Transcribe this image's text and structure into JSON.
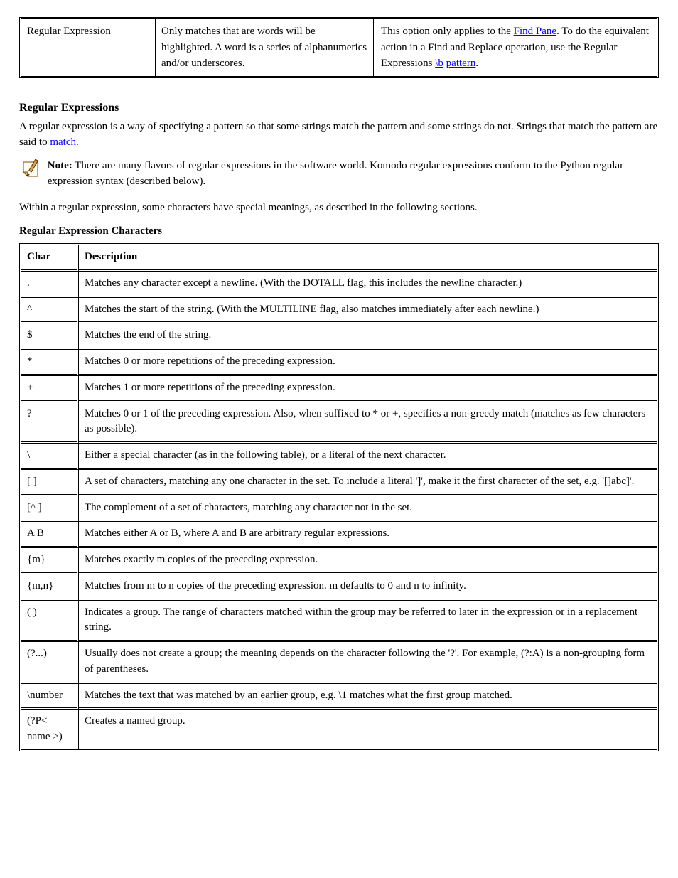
{
  "top": {
    "row": {
      "regex_label": "Regular Expression",
      "desc": "Only matches that are words will be highlighted. A word is a series of alphanumerics and/or underscores.",
      "note_prefix": "This option only applies to the ",
      "note_link1": "Find Pane",
      "note_mid": ". To do the equivalent action in a Find and Replace operation, use the Regular Expressions ",
      "note_link2": "\\b",
      "note_tail": " ",
      "note_link3": "pattern",
      "note_period": "."
    }
  },
  "section": {
    "title": "Regular Expressions",
    "para1": "A regular expression is a way of specifying a pattern so that some strings match the pattern and some strings do not. Strings that match the pattern are said to ",
    "para1_link": "match",
    "para1_tail": ".",
    "note_label": "Note:",
    "note_body": " There are many flavors of regular expressions in the software world. Komodo regular expressions conform to the Python regular expression syntax (described below).",
    "para2": "Within a regular expression, some characters have special meanings, as described in the following sections.",
    "regex_chars_heading": "Regular Expression Characters"
  },
  "regex_table": {
    "header": {
      "c1": "Char",
      "c2": "Description"
    },
    "rows": [
      {
        "c1": ".",
        "c2": "Matches any character except a newline. (With the DOTALL flag, this includes the newline character.)"
      },
      {
        "c1": "^",
        "c2": "Matches the start of the string. (With the MULTILINE flag, also matches immediately after each newline.)"
      },
      {
        "c1": "$",
        "c2": "Matches the end of the string."
      },
      {
        "c1": "*",
        "c2": "Matches 0 or more repetitions of the preceding expression."
      },
      {
        "c1": "+",
        "c2": "Matches 1 or more repetitions of the preceding expression."
      },
      {
        "c1": "?",
        "c2": "Matches 0 or 1 of the preceding expression. Also, when suffixed to * or +, specifies a non-greedy match (matches as few characters as possible)."
      },
      {
        "c1": "\\",
        "c2": "Either a special character (as in the following table), or a literal of the next character."
      },
      {
        "c1": "[ ]",
        "c2": "A set of characters, matching any one character in the set. To include a literal ']', make it the first character of the set, e.g. '[]abc]'."
      },
      {
        "c1": "[^ ]",
        "c2": "The complement of a set of characters, matching any character not in the set."
      },
      {
        "c1": "A|B",
        "c2": "Matches either A or B, where A and B are arbitrary regular expressions."
      },
      {
        "c1": "{m}",
        "c2": "Matches exactly m copies of the preceding expression."
      },
      {
        "c1": "{m,n}",
        "c2": "Matches from m to n copies of the preceding expression. m defaults to 0 and n to infinity."
      },
      {
        "c1": "( )",
        "c2": "Indicates a group. The range of characters matched within the group may be referred to later in the expression or in a replacement string."
      },
      {
        "c1": "(?...)",
        "c2": "Usually does not create a group; the meaning depends on the character following the '?'. For example, (?:A) is a non-grouping form of parentheses."
      },
      {
        "c1": "\\number",
        "c2": "Matches the text that was matched by an earlier group, e.g. \\1 matches what the first group matched."
      },
      {
        "c1": "(?P< name >)",
        "c2": "Creates a named group."
      }
    ]
  }
}
